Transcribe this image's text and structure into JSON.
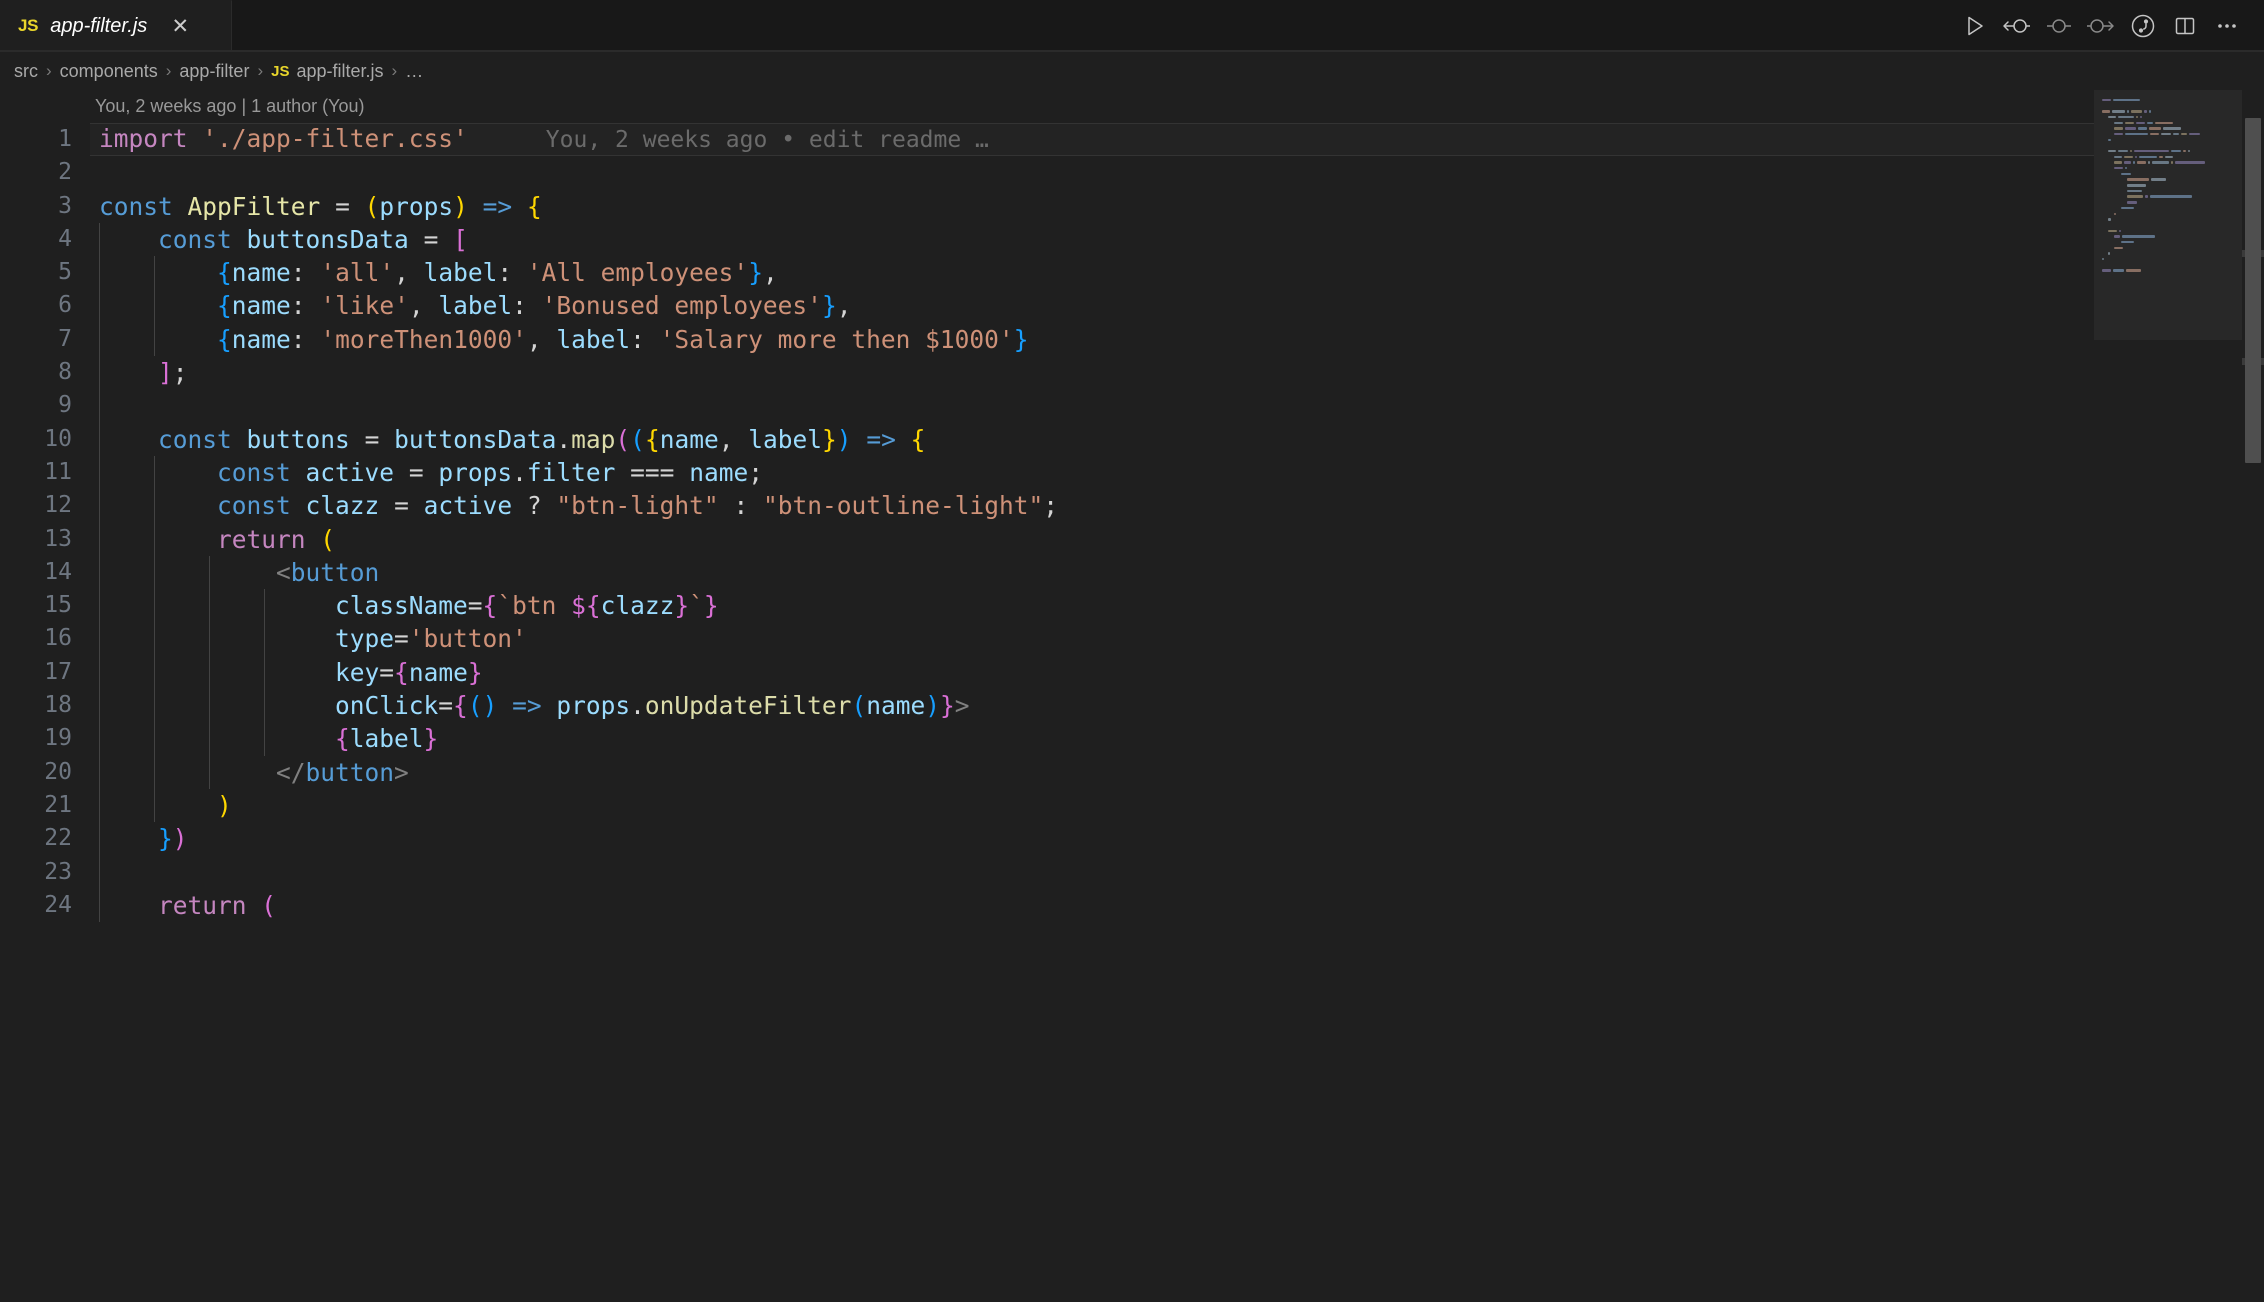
{
  "window": {
    "tab": {
      "file_badge": "JS",
      "filename": "app-filter.js",
      "close_glyph": "✕"
    },
    "actions": [
      {
        "name": "run-file-button",
        "label": "Run"
      },
      {
        "name": "previous-change-button",
        "label": "Previous Change"
      },
      {
        "name": "current-change-indicator",
        "label": "Change"
      },
      {
        "name": "next-change-button",
        "label": "Next Change"
      },
      {
        "name": "source-control-graph-button",
        "label": "Git Graph"
      },
      {
        "name": "split-editor-button",
        "label": "Split Editor Right"
      },
      {
        "name": "more-actions-button",
        "label": "More Actions..."
      }
    ]
  },
  "breadcrumb": {
    "items": [
      "src",
      "components",
      "app-filter"
    ],
    "file_badge": "JS",
    "file": "app-filter.js",
    "ellipsis": "…",
    "separator": "›"
  },
  "blame": {
    "header": "You, 2 weeks ago | 1 author (You)",
    "inline_line1": "You, 2 weeks ago • edit readme …"
  },
  "code": {
    "lines": [
      {
        "n": "1",
        "text": "import './app-filter.css'"
      },
      {
        "n": "2",
        "text": ""
      },
      {
        "n": "3",
        "text": "const AppFilter = (props) => {"
      },
      {
        "n": "4",
        "text": "    const buttonsData = ["
      },
      {
        "n": "5",
        "text": "        {name: 'all', label: 'All employees'},"
      },
      {
        "n": "6",
        "text": "        {name: 'like', label: 'Bonused employees'},"
      },
      {
        "n": "7",
        "text": "        {name: 'moreThen1000', label: 'Salary more then $1000'}"
      },
      {
        "n": "8",
        "text": "    ];"
      },
      {
        "n": "9",
        "text": ""
      },
      {
        "n": "10",
        "text": "    const buttons = buttonsData.map(({name, label}) => {"
      },
      {
        "n": "11",
        "text": "        const active = props.filter === name;"
      },
      {
        "n": "12",
        "text": "        const clazz = active ? \"btn-light\" : \"btn-outline-light\";"
      },
      {
        "n": "13",
        "text": "        return ("
      },
      {
        "n": "14",
        "text": "            <button"
      },
      {
        "n": "15",
        "text": "                className={`btn ${clazz}`}"
      },
      {
        "n": "16",
        "text": "                type='button'"
      },
      {
        "n": "17",
        "text": "                key={name}"
      },
      {
        "n": "18",
        "text": "                onClick={() => props.onUpdateFilter(name)}>"
      },
      {
        "n": "19",
        "text": "                {label}"
      },
      {
        "n": "20",
        "text": "            </button>"
      },
      {
        "n": "21",
        "text": "        )"
      },
      {
        "n": "22",
        "text": "    })"
      },
      {
        "n": "23",
        "text": ""
      },
      {
        "n": "24",
        "text": "    return ("
      }
    ]
  },
  "colors": {
    "editor_background": "#1f1f1f",
    "tabbar_background": "#181818",
    "current_line_background": "#232323",
    "line_number": "#6e7681",
    "keyword_purple": "#c586c0",
    "keyword_blue": "#569cd6",
    "string": "#ce9178",
    "variable": "#9cdcfe",
    "function": "#dcdcaa",
    "bracket_level1": "#ffd700",
    "bracket_level2": "#da70d6",
    "bracket_level3": "#179fff",
    "js_badge": "#e9d62b",
    "blame_text": "#6b6b6b",
    "scrollbar_thumb": "#4f4f4f"
  }
}
